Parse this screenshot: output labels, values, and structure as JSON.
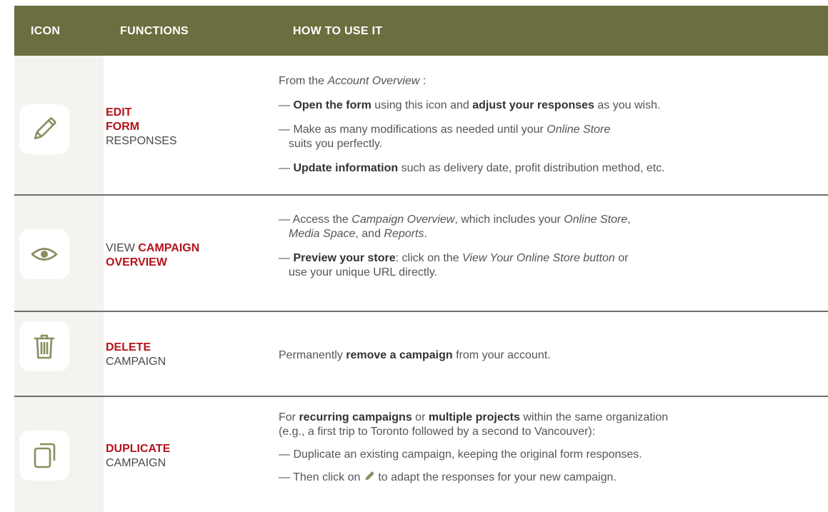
{
  "header": {
    "col_icon": "ICON",
    "col_functions": "FUNCTIONS",
    "col_how": "HOW TO USE IT"
  },
  "colors": {
    "header_bg": "#6b6f3f",
    "accent_red": "#b5121b",
    "icon_color": "#8a8d5e",
    "icon_column_bg": "#f4f3ef"
  },
  "rows": [
    {
      "icon": "pencil-icon",
      "fn": {
        "l1": "EDIT",
        "l2": "FORM",
        "l3": "RESPONSES"
      },
      "how": {
        "intro_a": "From the ",
        "intro_b": "Account Overview",
        "intro_c": " :",
        "b1_dash": "— ",
        "b1_bold1": "Open the form",
        "b1_t1": " using this icon and ",
        "b1_bold2": "adjust your responses",
        "b1_t2": " as you wish.",
        "b2_t1": "— Make as many modifications as needed until your ",
        "b2_i1": "Online Store",
        "b2_t2": "suits you perfectly.",
        "b3_dash": "— ",
        "b3_bold": "Update information",
        "b3_t": " such as delivery date, profit distribution method, etc."
      }
    },
    {
      "icon": "eye-icon",
      "fn": {
        "l1_plain": "VIEW ",
        "l1_red": "CAMPAIGN",
        "l2_red": "OVERVIEW"
      },
      "how": {
        "b1_t1": "— Access the ",
        "b1_i1": "Campaign Overview",
        "b1_t2": ", which includes your ",
        "b1_i2": "Online Store",
        "b1_t3": ",",
        "b1_i3": "Media Space",
        "b1_t4": ", and ",
        "b1_i4": "Reports",
        "b1_t5": ".",
        "b2_dash": "— ",
        "b2_bold": "Preview your store",
        "b2_t1": ": click on the ",
        "b2_i1": "View Your Online Store button",
        "b2_t2": " or",
        "b2_t3": "use your unique URL directly."
      }
    },
    {
      "icon": "trash-icon",
      "fn": {
        "l1": "DELETE",
        "l2": "CAMPAIGN"
      },
      "how": {
        "t1": "Permanently ",
        "bold": "remove a campaign",
        "t2": " from your account."
      }
    },
    {
      "icon": "duplicate-icon",
      "fn": {
        "l1": "DUPLICATE",
        "l2": "CAMPAIGN"
      },
      "how": {
        "intro_t1": "For ",
        "intro_bold1": "recurring campaigns",
        "intro_t2": " or ",
        "intro_bold2": "multiple projects",
        "intro_t3": " within the same organization",
        "intro_line2": "(e.g., a first trip to Toronto followed by a second to Vancouver):",
        "b1": "— Duplicate an existing campaign, keeping the original form responses.",
        "b2_t1": "— Then click on ",
        "b2_t2": " to adapt the responses for your new campaign."
      }
    }
  ]
}
